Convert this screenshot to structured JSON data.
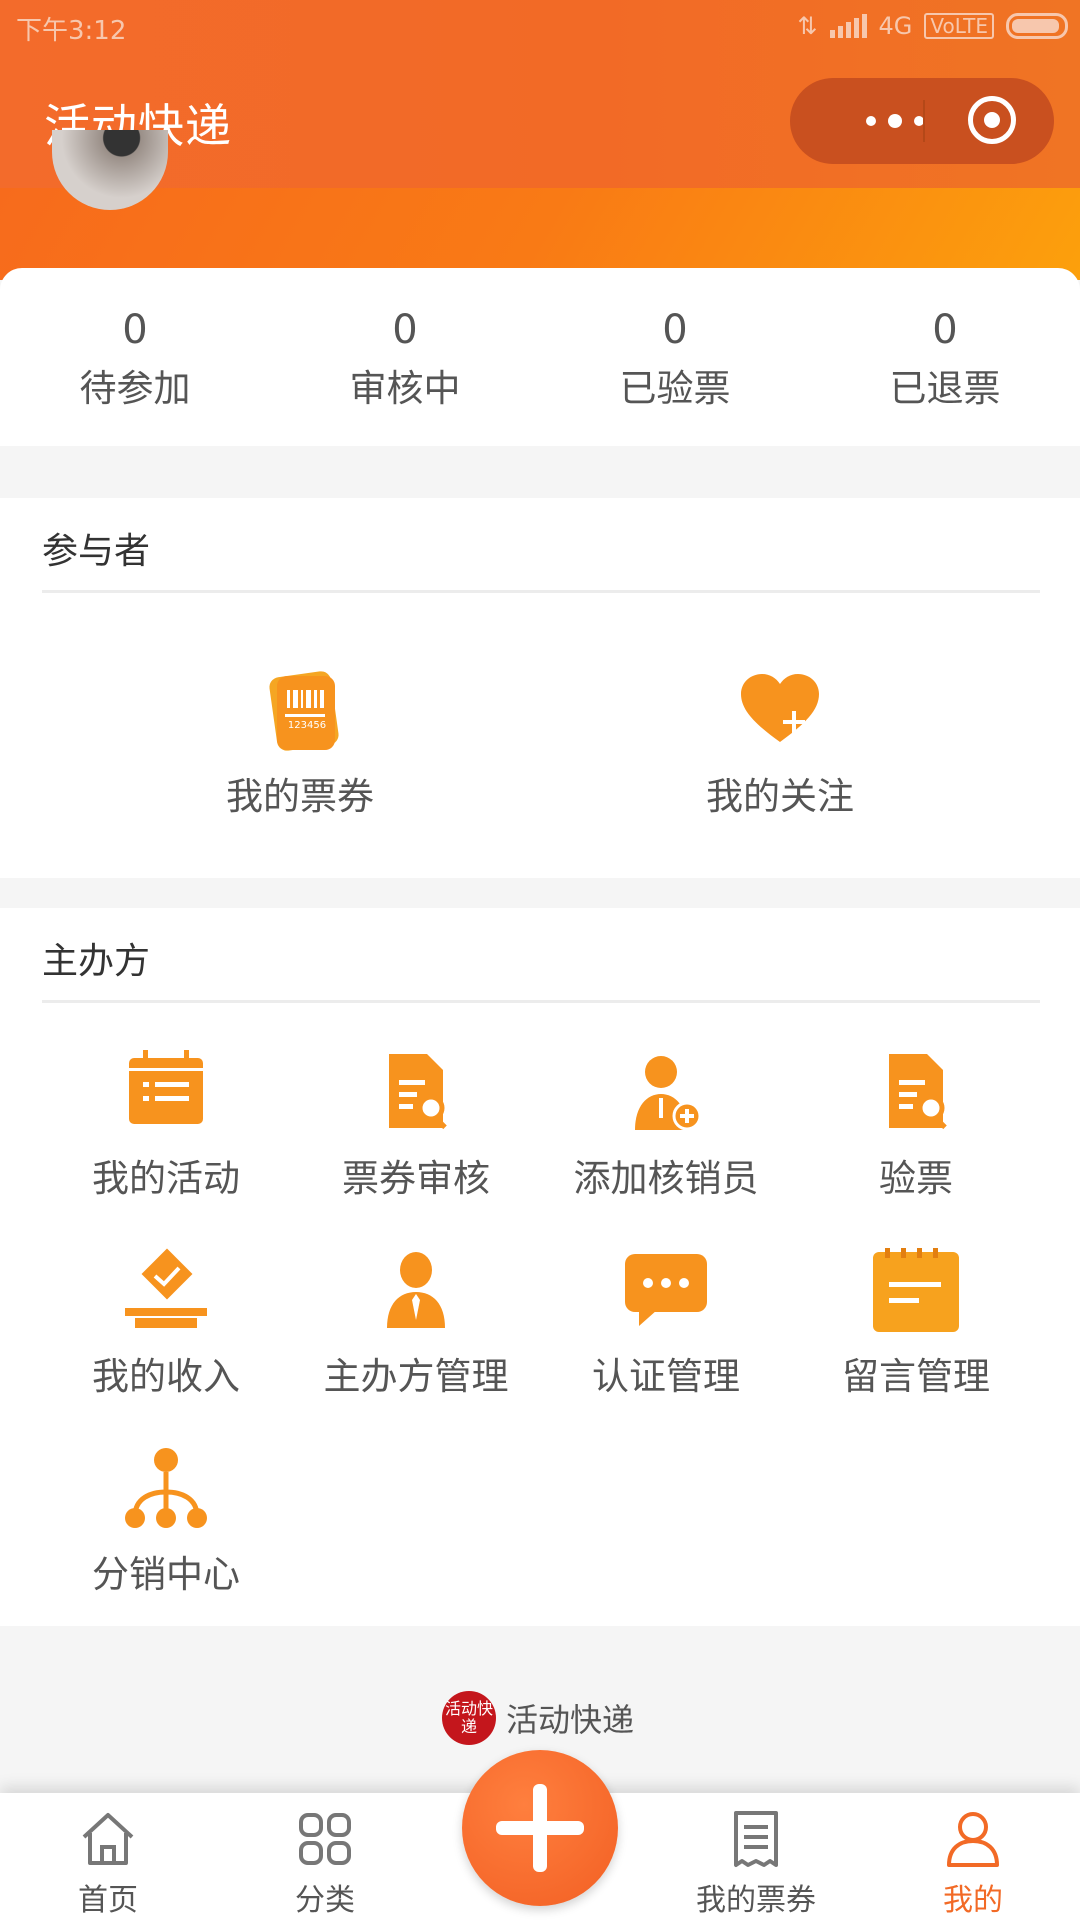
{
  "status_bar": {
    "time": "下午3:12",
    "network": "4G",
    "volte": "VoLTE"
  },
  "nav": {
    "title": "活动快递"
  },
  "stats": [
    {
      "num": "0",
      "label": "待参加"
    },
    {
      "num": "0",
      "label": "审核中"
    },
    {
      "num": "0",
      "label": "已验票"
    },
    {
      "num": "0",
      "label": "已退票"
    }
  ],
  "participant": {
    "title": "参与者",
    "items": [
      {
        "label": "我的票券",
        "icon": "ticket-barcode-icon",
        "code": "123456"
      },
      {
        "label": "我的关注",
        "icon": "heart-plus-icon"
      }
    ]
  },
  "organizer": {
    "title": "主办方",
    "items": [
      {
        "label": "我的活动",
        "icon": "calendar-list-icon"
      },
      {
        "label": "票券审核",
        "icon": "document-search-icon"
      },
      {
        "label": "添加核销员",
        "icon": "user-add-icon"
      },
      {
        "label": "验票",
        "icon": "document-search-icon"
      },
      {
        "label": "我的收入",
        "icon": "ballot-check-icon"
      },
      {
        "label": "主办方管理",
        "icon": "person-tie-icon"
      },
      {
        "label": "认证管理",
        "icon": "chat-bubble-icon"
      },
      {
        "label": "留言管理",
        "icon": "notepad-icon"
      },
      {
        "label": "分销中心",
        "icon": "network-tree-icon"
      }
    ]
  },
  "footer": {
    "brand": "活动快递",
    "logo_text": "活动快递"
  },
  "tabbar": [
    {
      "label": "首页",
      "icon": "home-icon"
    },
    {
      "label": "分类",
      "icon": "grid-icon"
    },
    {
      "label": "",
      "icon": "plus-icon"
    },
    {
      "label": "我的票券",
      "icon": "receipt-icon"
    },
    {
      "label": "我的",
      "icon": "user-icon",
      "active": true
    }
  ],
  "colors": {
    "accent": "#f26a26",
    "icon_orange": "#f7931e",
    "brand_red": "#c4161c"
  }
}
